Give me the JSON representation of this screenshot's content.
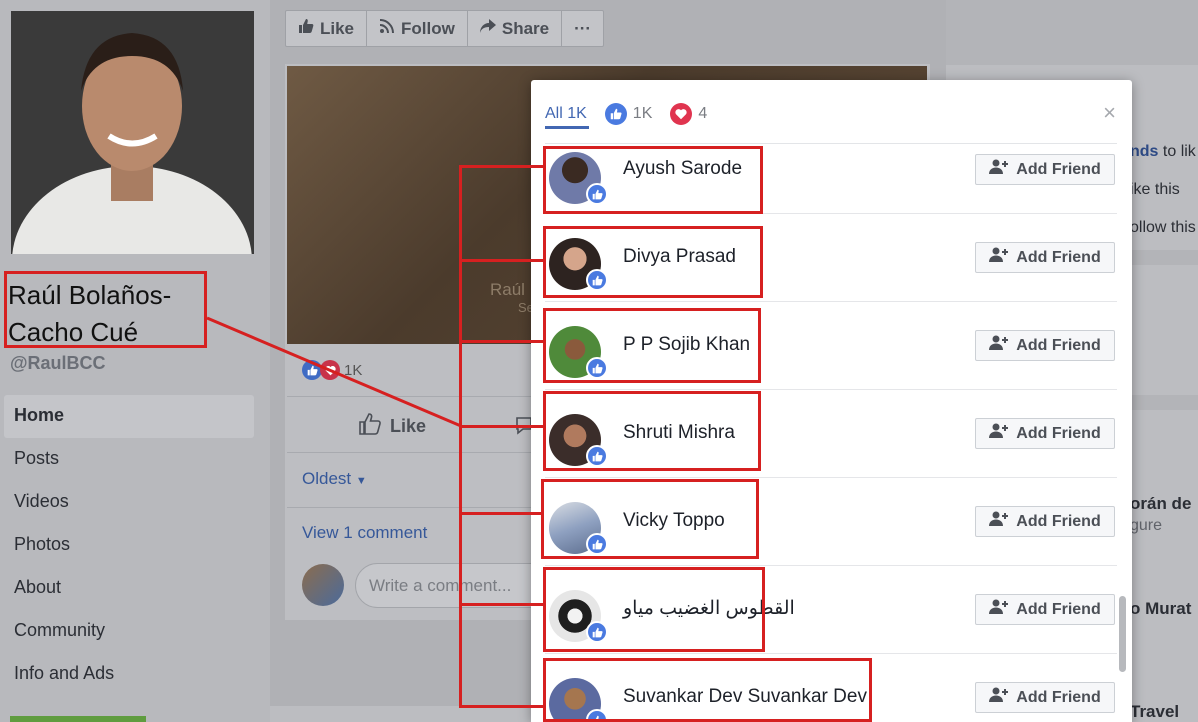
{
  "page": {
    "name": "Raúl Bolaños-Cacho Cué",
    "handle": "@RaulBCC"
  },
  "nav": {
    "items": [
      {
        "label": "Home",
        "active": true
      },
      {
        "label": "Posts"
      },
      {
        "label": "Videos"
      },
      {
        "label": "Photos"
      },
      {
        "label": "About"
      },
      {
        "label": "Community"
      },
      {
        "label": "Info and Ads"
      }
    ]
  },
  "actionbar": {
    "like": "Like",
    "follow": "Follow",
    "share": "Share",
    "more": "···"
  },
  "post": {
    "image_text": "Raúl",
    "image_text2": "Se",
    "reaction_count": "1K",
    "like_action": "Like",
    "sort_label": "Oldest",
    "view_comments": "View 1 comment",
    "comment_placeholder": "Write a comment..."
  },
  "right": {
    "friends_link": "nds",
    "friends_text": "to lik",
    "like_this": "ike this",
    "follow_this": "ollow this",
    "suggest1_name": "orán de",
    "suggest1_sub": "gure",
    "suggest2_name": "o Murat",
    "suggest3_name": "Travel"
  },
  "modal": {
    "tabs": {
      "all": "All 1K",
      "like": "1K",
      "love": "4"
    },
    "close": "×",
    "add_friend_label": "Add Friend",
    "people": [
      {
        "name": "Ayush Sarode"
      },
      {
        "name": "Divya Prasad"
      },
      {
        "name": "P P Sojib Khan"
      },
      {
        "name": "Shruti Mishra"
      },
      {
        "name": "Vicky Toppo"
      },
      {
        "name": "القطوس الغضيب مياو"
      },
      {
        "name": "Suvankar Dev Suvankar Dev"
      }
    ]
  },
  "colors": {
    "annotation_red": "#d62020",
    "facebook_blue": "#4267b2",
    "like_blue": "#4a7ae0",
    "love_red": "#e0344f"
  }
}
